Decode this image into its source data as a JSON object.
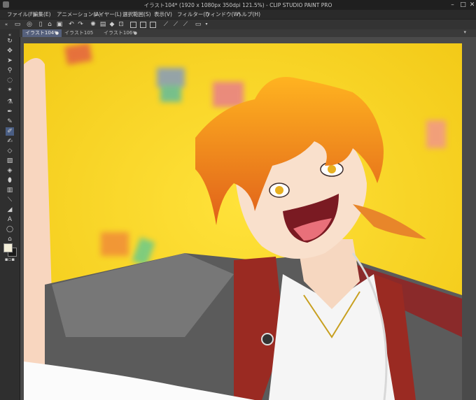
{
  "window": {
    "title": "イラスト104* (1920 x 1080px 350dpi 121.5%) - CLIP STUDIO PAINT PRO",
    "controls": [
      "–",
      "□",
      "✕"
    ]
  },
  "menu": [
    "ファイル(F)",
    "編集(E)",
    "アニメーション(A)",
    "レイヤー(L)",
    "選択範囲(S)",
    "表示(V)",
    "フィルター(I)",
    "ウィンドウ(W)",
    "ヘルプ(H)"
  ],
  "tabs": [
    {
      "label": "イラスト104*",
      "active": true
    },
    {
      "label": "イラスト105",
      "active": false
    },
    {
      "label": "イラスト106*",
      "active": false
    }
  ],
  "tab_close_glyph": "●",
  "colors": {
    "accent": "#4a5e84",
    "canvas_background": "#f3d31a",
    "foreground_swatch": "#f3eed8",
    "background_swatch": "#1a1a1a"
  },
  "tools": [
    "collapse-icon",
    "rotate-view-icon",
    "move-icon",
    "object-select-icon",
    "zoom-icon",
    "lasso-icon",
    "magic-wand-icon",
    "eyedropper-icon",
    "pen-icon",
    "pencil-icon",
    "brush-icon",
    "airbrush-icon",
    "eraser-icon",
    "blend-icon",
    "fill-icon",
    "gradient-icon",
    "figure-icon",
    "text-icon",
    "speech-balloon-icon",
    "ruler-icon",
    "color-swatch-icon"
  ]
}
